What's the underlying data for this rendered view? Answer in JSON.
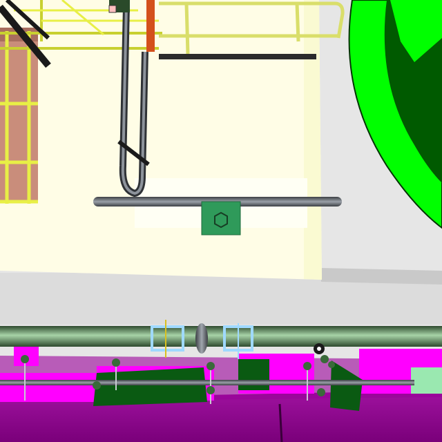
{
  "scene": {
    "kind": "3d-plant-model-viewport",
    "colors": {
      "background": "#e6e6e6",
      "wall_panel": "#fffde6",
      "walkway_green": "#00ff00",
      "walkway_dark": "#005a00",
      "railing_yellow": "#e8ef46",
      "pipe_green": "#5e8f5e",
      "pipe_dark": "#2e4a2e",
      "valve_green": "#2f9a5a",
      "support_magenta": "#ff00ff",
      "structure_purple": "#8b008b",
      "steel_grey": "#6b6f78",
      "clamp_blue": "#9fd9ff",
      "brown_panel": "#c98d7b"
    },
    "objects": [
      "wall-panel",
      "railing-structure",
      "hanging-u-pipe",
      "horizontal-pipe",
      "valve-handle",
      "green-walkway",
      "main-pipe",
      "pipe-clamp",
      "magenta-supports",
      "purple-structure",
      "flanges"
    ]
  }
}
